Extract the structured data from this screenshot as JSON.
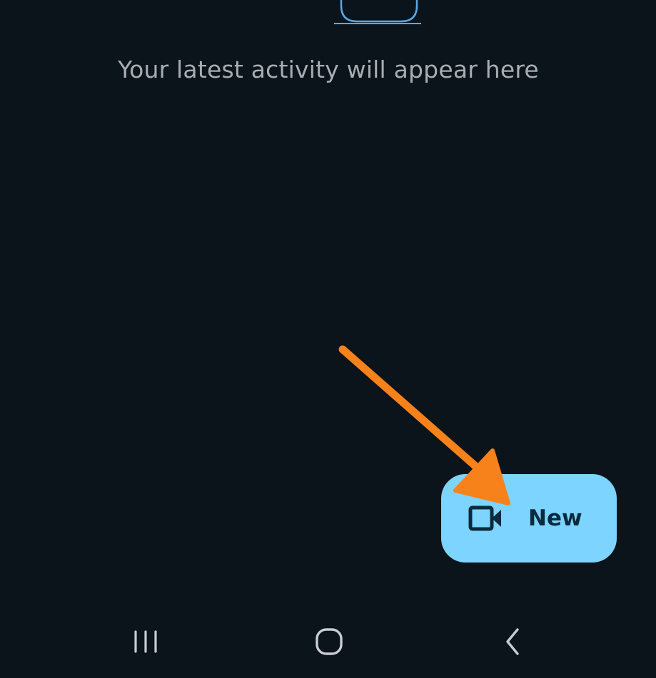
{
  "empty_state": {
    "message": "Your latest activity will appear here"
  },
  "fab": {
    "label": "New",
    "icon": "video-camera-icon",
    "background_color": "#7cd4ff",
    "text_color": "#0b2a3d"
  },
  "annotation": {
    "icon": "orange-arrow-icon",
    "color": "#f7821b"
  },
  "nav_bar": {
    "recent": "recent-apps-icon",
    "home": "home-icon",
    "back": "back-icon"
  },
  "colors": {
    "background": "#0b131b",
    "message_text": "#a9adb2",
    "illustration_stroke": "#5aa9e6"
  }
}
